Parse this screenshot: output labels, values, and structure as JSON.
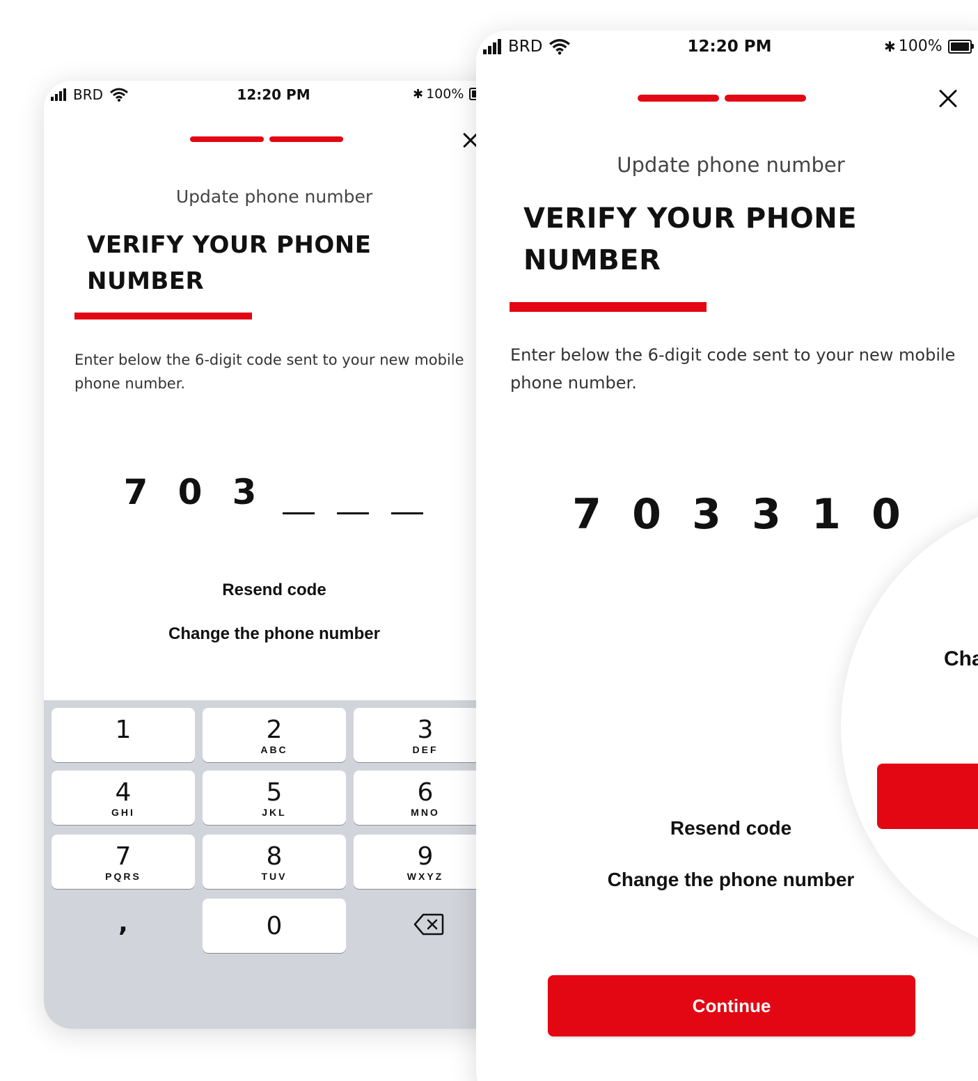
{
  "left_screen": {
    "status": {
      "carrier": "BRD",
      "time": "12:20 PM",
      "battery": "100%"
    },
    "subtitle": "Update phone number",
    "title_line1": "VERIFY YOUR PHONE",
    "title_line2": "NUMBER",
    "instruction": "Enter below the 6-digit code sent to your new mobile phone number.",
    "code": [
      "7",
      "0",
      "3",
      "",
      "",
      ""
    ],
    "resend": "Resend code",
    "change": "Change the phone number",
    "keypad": {
      "keys": [
        {
          "num": "1",
          "letters": ""
        },
        {
          "num": "2",
          "letters": "ABC"
        },
        {
          "num": "3",
          "letters": "DEF"
        },
        {
          "num": "4",
          "letters": "GHI"
        },
        {
          "num": "5",
          "letters": "JKL"
        },
        {
          "num": "6",
          "letters": "MNO"
        },
        {
          "num": "7",
          "letters": "PQRS"
        },
        {
          "num": "8",
          "letters": "TUV"
        },
        {
          "num": "9",
          "letters": "WXYZ"
        },
        {
          "num": "0",
          "letters": ""
        }
      ],
      "comma": ",",
      "delete_icon": "backspace-icon"
    }
  },
  "right_screen": {
    "status": {
      "carrier": "BRD",
      "time": "12:20 PM",
      "battery": "100%"
    },
    "subtitle": "Update phone number",
    "title_line1": "VERIFY YOUR PHONE",
    "title_line2": "NUMBER",
    "instruction": "Enter below the 6-digit code sent to your new mobile phone number.",
    "code": [
      "7",
      "0",
      "3",
      "3",
      "1",
      "0"
    ],
    "resend": "Resend code",
    "change": "Change the phone number",
    "continue": "Continue"
  },
  "magnifier": {
    "text": "Cha"
  },
  "colors": {
    "accent": "#e30613",
    "keypad_bg": "#d1d4da"
  }
}
